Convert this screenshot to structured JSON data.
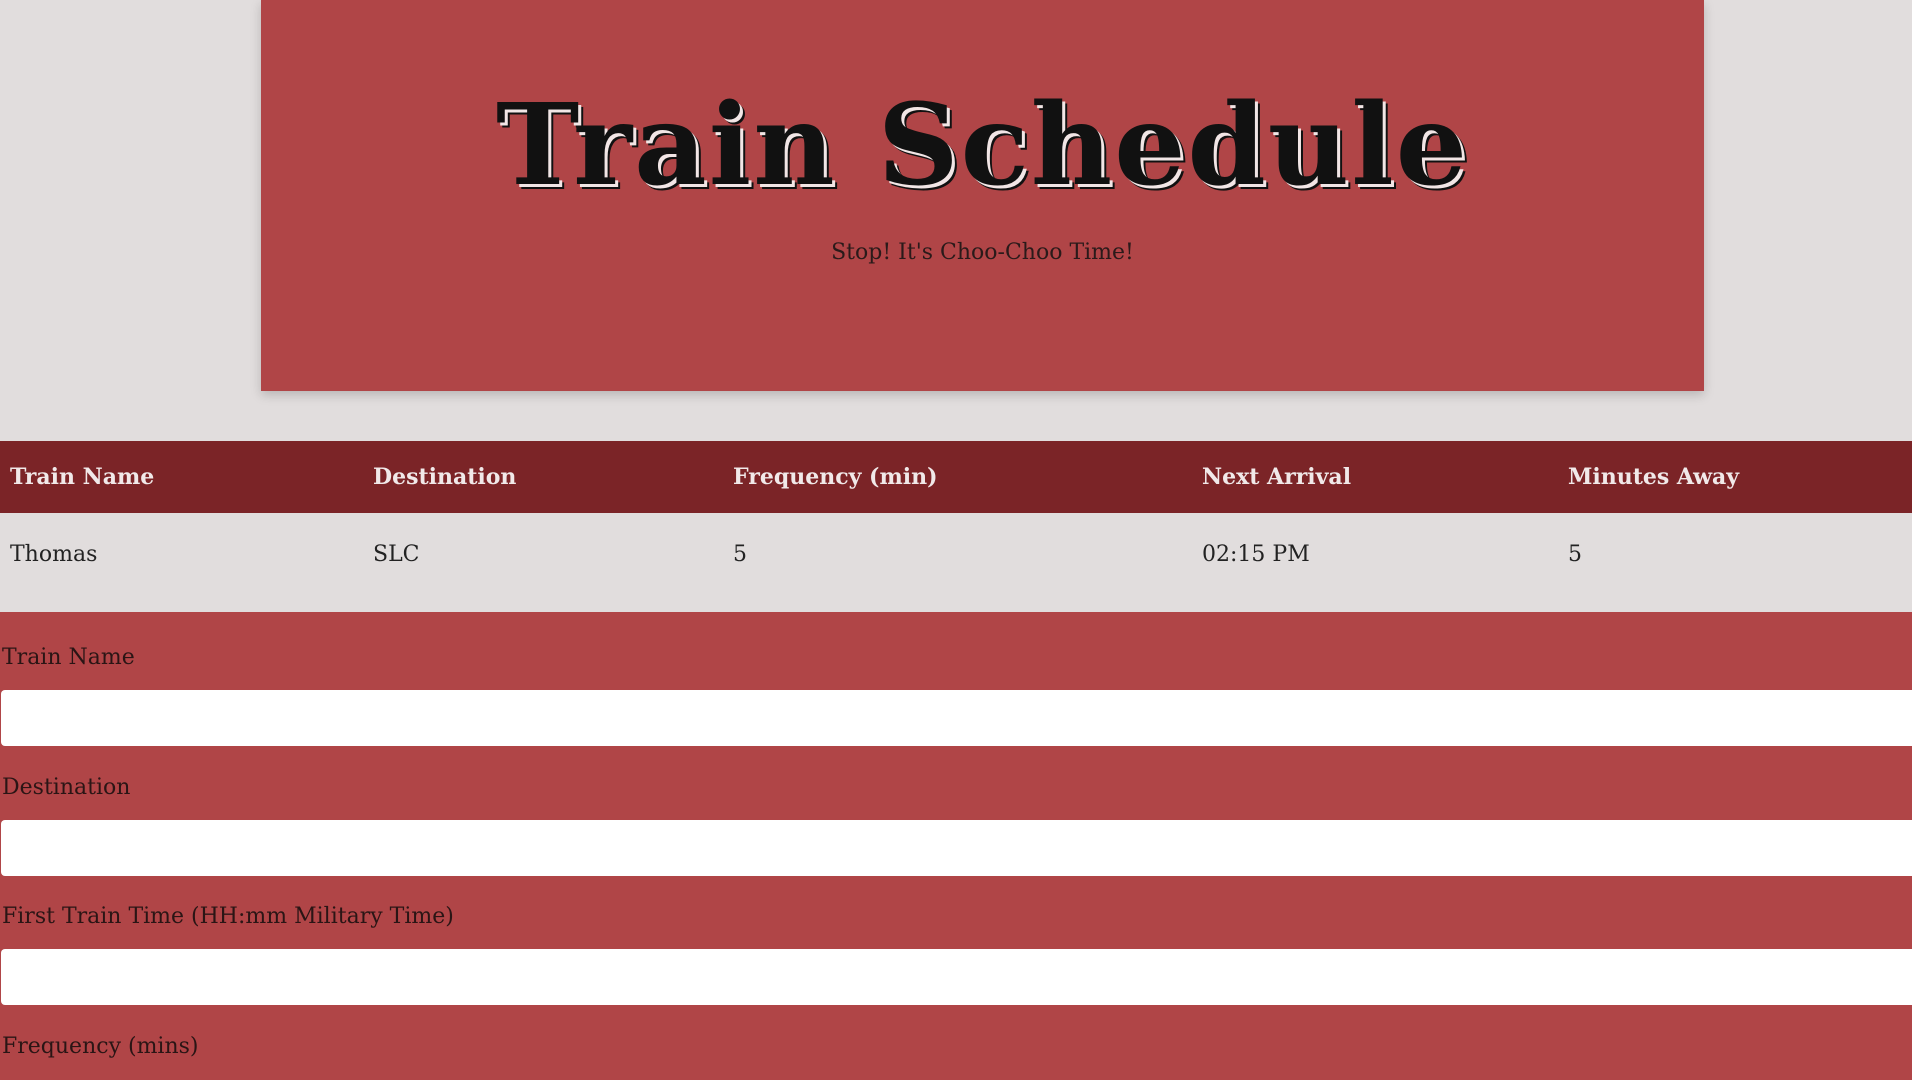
{
  "header": {
    "title": "Train Schedule",
    "subtitle": "Stop! It's Choo-Choo Time!"
  },
  "table": {
    "columns": [
      "Train Name",
      "Destination",
      "Frequency (min)",
      "Next Arrival",
      "Minutes Away"
    ],
    "rows": [
      [
        "Thomas",
        "SLC",
        "5",
        "02:15 PM",
        "5"
      ]
    ]
  },
  "form": {
    "fields": [
      {
        "label": "Train Name",
        "value": ""
      },
      {
        "label": "Destination",
        "value": ""
      },
      {
        "label": "First Train Time (HH:mm Military Time)",
        "value": ""
      },
      {
        "label": "Frequency (mins)",
        "value": ""
      }
    ]
  },
  "colors": {
    "background": "#e1dddd",
    "accent": "#b04547",
    "table_header": "#7b2427"
  }
}
